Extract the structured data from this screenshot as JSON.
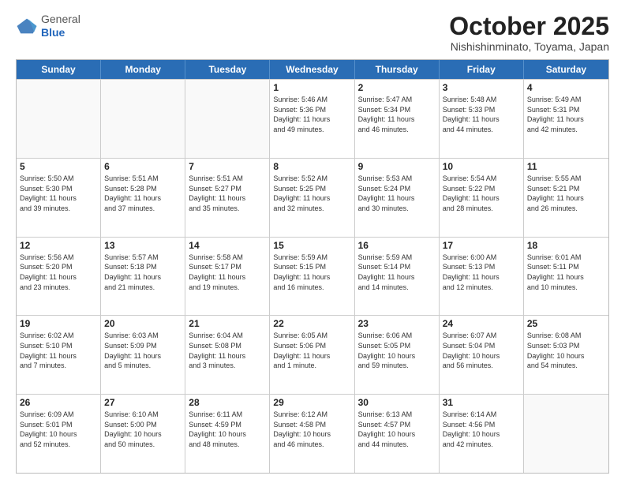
{
  "logo": {
    "general": "General",
    "blue": "Blue"
  },
  "header": {
    "month": "October 2025",
    "location": "Nishishinminato, Toyama, Japan"
  },
  "weekdays": [
    "Sunday",
    "Monday",
    "Tuesday",
    "Wednesday",
    "Thursday",
    "Friday",
    "Saturday"
  ],
  "weeks": [
    [
      {
        "day": "",
        "info": ""
      },
      {
        "day": "",
        "info": ""
      },
      {
        "day": "",
        "info": ""
      },
      {
        "day": "1",
        "info": "Sunrise: 5:46 AM\nSunset: 5:36 PM\nDaylight: 11 hours\nand 49 minutes."
      },
      {
        "day": "2",
        "info": "Sunrise: 5:47 AM\nSunset: 5:34 PM\nDaylight: 11 hours\nand 46 minutes."
      },
      {
        "day": "3",
        "info": "Sunrise: 5:48 AM\nSunset: 5:33 PM\nDaylight: 11 hours\nand 44 minutes."
      },
      {
        "day": "4",
        "info": "Sunrise: 5:49 AM\nSunset: 5:31 PM\nDaylight: 11 hours\nand 42 minutes."
      }
    ],
    [
      {
        "day": "5",
        "info": "Sunrise: 5:50 AM\nSunset: 5:30 PM\nDaylight: 11 hours\nand 39 minutes."
      },
      {
        "day": "6",
        "info": "Sunrise: 5:51 AM\nSunset: 5:28 PM\nDaylight: 11 hours\nand 37 minutes."
      },
      {
        "day": "7",
        "info": "Sunrise: 5:51 AM\nSunset: 5:27 PM\nDaylight: 11 hours\nand 35 minutes."
      },
      {
        "day": "8",
        "info": "Sunrise: 5:52 AM\nSunset: 5:25 PM\nDaylight: 11 hours\nand 32 minutes."
      },
      {
        "day": "9",
        "info": "Sunrise: 5:53 AM\nSunset: 5:24 PM\nDaylight: 11 hours\nand 30 minutes."
      },
      {
        "day": "10",
        "info": "Sunrise: 5:54 AM\nSunset: 5:22 PM\nDaylight: 11 hours\nand 28 minutes."
      },
      {
        "day": "11",
        "info": "Sunrise: 5:55 AM\nSunset: 5:21 PM\nDaylight: 11 hours\nand 26 minutes."
      }
    ],
    [
      {
        "day": "12",
        "info": "Sunrise: 5:56 AM\nSunset: 5:20 PM\nDaylight: 11 hours\nand 23 minutes."
      },
      {
        "day": "13",
        "info": "Sunrise: 5:57 AM\nSunset: 5:18 PM\nDaylight: 11 hours\nand 21 minutes."
      },
      {
        "day": "14",
        "info": "Sunrise: 5:58 AM\nSunset: 5:17 PM\nDaylight: 11 hours\nand 19 minutes."
      },
      {
        "day": "15",
        "info": "Sunrise: 5:59 AM\nSunset: 5:15 PM\nDaylight: 11 hours\nand 16 minutes."
      },
      {
        "day": "16",
        "info": "Sunrise: 5:59 AM\nSunset: 5:14 PM\nDaylight: 11 hours\nand 14 minutes."
      },
      {
        "day": "17",
        "info": "Sunrise: 6:00 AM\nSunset: 5:13 PM\nDaylight: 11 hours\nand 12 minutes."
      },
      {
        "day": "18",
        "info": "Sunrise: 6:01 AM\nSunset: 5:11 PM\nDaylight: 11 hours\nand 10 minutes."
      }
    ],
    [
      {
        "day": "19",
        "info": "Sunrise: 6:02 AM\nSunset: 5:10 PM\nDaylight: 11 hours\nand 7 minutes."
      },
      {
        "day": "20",
        "info": "Sunrise: 6:03 AM\nSunset: 5:09 PM\nDaylight: 11 hours\nand 5 minutes."
      },
      {
        "day": "21",
        "info": "Sunrise: 6:04 AM\nSunset: 5:08 PM\nDaylight: 11 hours\nand 3 minutes."
      },
      {
        "day": "22",
        "info": "Sunrise: 6:05 AM\nSunset: 5:06 PM\nDaylight: 11 hours\nand 1 minute."
      },
      {
        "day": "23",
        "info": "Sunrise: 6:06 AM\nSunset: 5:05 PM\nDaylight: 10 hours\nand 59 minutes."
      },
      {
        "day": "24",
        "info": "Sunrise: 6:07 AM\nSunset: 5:04 PM\nDaylight: 10 hours\nand 56 minutes."
      },
      {
        "day": "25",
        "info": "Sunrise: 6:08 AM\nSunset: 5:03 PM\nDaylight: 10 hours\nand 54 minutes."
      }
    ],
    [
      {
        "day": "26",
        "info": "Sunrise: 6:09 AM\nSunset: 5:01 PM\nDaylight: 10 hours\nand 52 minutes."
      },
      {
        "day": "27",
        "info": "Sunrise: 6:10 AM\nSunset: 5:00 PM\nDaylight: 10 hours\nand 50 minutes."
      },
      {
        "day": "28",
        "info": "Sunrise: 6:11 AM\nSunset: 4:59 PM\nDaylight: 10 hours\nand 48 minutes."
      },
      {
        "day": "29",
        "info": "Sunrise: 6:12 AM\nSunset: 4:58 PM\nDaylight: 10 hours\nand 46 minutes."
      },
      {
        "day": "30",
        "info": "Sunrise: 6:13 AM\nSunset: 4:57 PM\nDaylight: 10 hours\nand 44 minutes."
      },
      {
        "day": "31",
        "info": "Sunrise: 6:14 AM\nSunset: 4:56 PM\nDaylight: 10 hours\nand 42 minutes."
      },
      {
        "day": "",
        "info": ""
      }
    ]
  ]
}
